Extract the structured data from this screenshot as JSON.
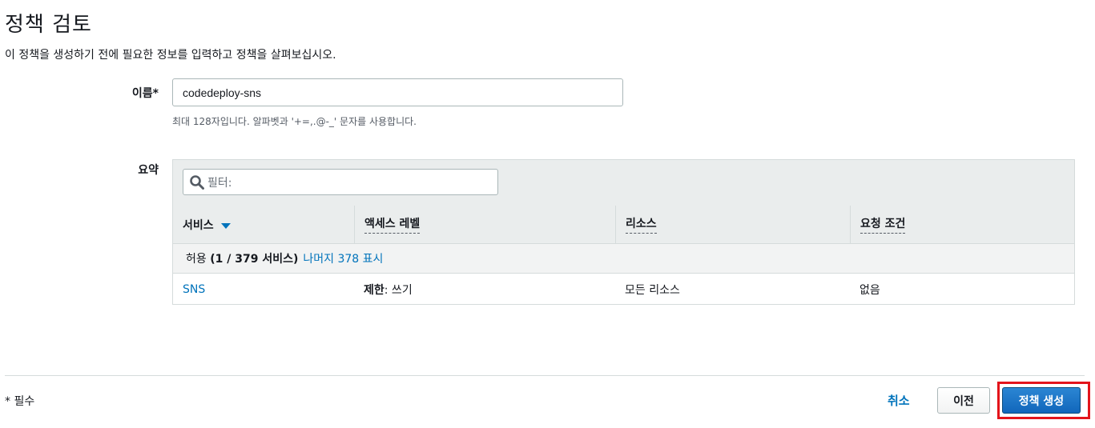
{
  "header": {
    "title": "정책 검토",
    "description": "이 정책을 생성하기 전에 필요한 정보를 입력하고 정책을 살펴보십시오."
  },
  "name_field": {
    "label": "이름*",
    "value": "codedeploy-sns",
    "hint": "최대 128자입니다. 알파벳과 '+=,.@-_' 문자를 사용합니다."
  },
  "summary": {
    "label": "요약",
    "filter_placeholder": "필터:",
    "columns": {
      "service": "서비스",
      "access_level": "액세스 레벨",
      "resource": "리소스",
      "request_condition": "요청 조건"
    },
    "group": {
      "prefix": "허용",
      "count": "(1 / 379 서비스)",
      "show_rest_link": "나머지 378 표시"
    },
    "rows": [
      {
        "service": "SNS",
        "access_level_bold": "제한",
        "access_level_rest": ": 쓰기",
        "resource": "모든 리소스",
        "request_condition": "없음"
      }
    ]
  },
  "footer": {
    "required_note": "* 필수",
    "cancel_label": "취소",
    "previous_label": "이전",
    "create_label": "정책 생성"
  },
  "colors": {
    "link": "#0073bb",
    "primary_button": "#1166bb",
    "highlight": "#e3141b"
  }
}
